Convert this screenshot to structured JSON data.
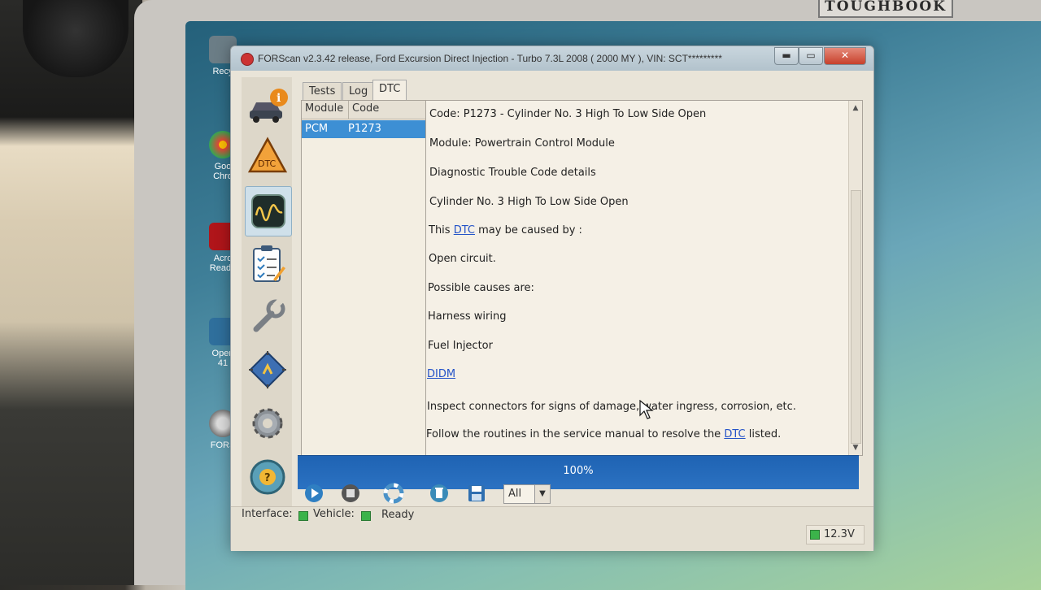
{
  "device": {
    "brand": "TOUGHBOOK"
  },
  "desktop_icons": [
    {
      "label": "Recy"
    },
    {
      "label": "Goo\nChro"
    },
    {
      "label": "Acro\nReade"
    },
    {
      "label": "Open\n41"
    },
    {
      "label": "FORS"
    }
  ],
  "window": {
    "title": "FORScan v2.3.42 release, Ford Excursion Direct Injection - Turbo 7.3L 2008 ( 2000 MY ), VIN: SCT*********",
    "buttons": {
      "minimize": "▬",
      "maximize": "▭",
      "close": "✕"
    }
  },
  "sidebar": {
    "items": [
      {
        "name": "vehicle-info",
        "icon": "car-info-icon"
      },
      {
        "name": "dtc",
        "icon": "dtc-warning-icon",
        "label": "DTC"
      },
      {
        "name": "oscilloscope",
        "icon": "oscilloscope-icon"
      },
      {
        "name": "tests",
        "icon": "checklist-icon"
      },
      {
        "name": "service",
        "icon": "wrench-icon"
      },
      {
        "name": "configuration",
        "icon": "chip-icon"
      },
      {
        "name": "settings",
        "icon": "gear-icon"
      },
      {
        "name": "help",
        "icon": "help-icon"
      }
    ]
  },
  "tabs": [
    {
      "label": "Tests"
    },
    {
      "label": "Log"
    },
    {
      "label": "DTC",
      "active": true
    }
  ],
  "dtc_list": {
    "columns": [
      "Module",
      "Code"
    ],
    "rows": [
      {
        "module": "PCM",
        "code": "P1273",
        "selected": true
      }
    ]
  },
  "detail": {
    "code_line": "Code: P1273 - Cylinder No. 3 High To Low Side Open",
    "module_line": "Module: Powertrain Control Module",
    "details_heading": "Diagnostic Trouble Code details",
    "description": "Cylinder No. 3 High To Low Side Open",
    "caused_by_pre": "This ",
    "caused_by_link": "DTC",
    "caused_by_post": " may be caused by :",
    "cause_1": "Open circuit.",
    "possible_causes": "Possible causes are:",
    "cause_harness": "Harness wiring",
    "cause_injector": "Fuel Injector",
    "didm_link": "DIDM",
    "inspect_line": "Inspect connectors for signs of damage, water ingress, corrosion, etc.",
    "follow_pre": "Follow the routines in the service manual to resolve the ",
    "follow_link": "DTC",
    "follow_post": " listed."
  },
  "progress": {
    "text": "100%",
    "value": 1.0
  },
  "toolbar": {
    "buttons": [
      "play-icon",
      "stop-icon",
      "lifebuoy-icon",
      "clear-icon",
      "save-icon"
    ],
    "filter_value": "All"
  },
  "status": {
    "interface_label": "Interface:",
    "vehicle_label": "Vehicle:",
    "state": "Ready",
    "voltage": "12.3V",
    "led_color": "#3bb34a"
  }
}
